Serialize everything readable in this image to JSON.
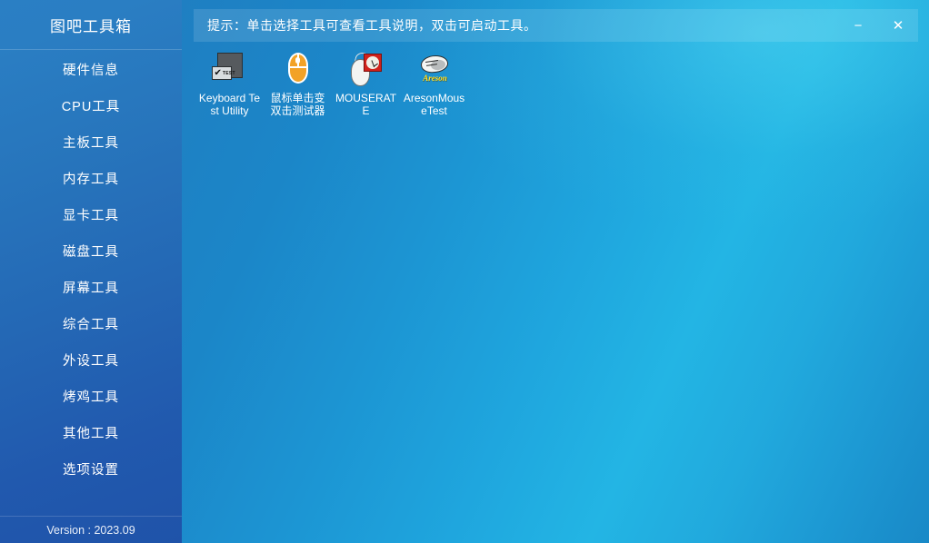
{
  "sidebar": {
    "title": "图吧工具箱",
    "items": [
      {
        "label": "硬件信息",
        "name": "sidebar-item-hardware-info"
      },
      {
        "label": "CPU工具",
        "name": "sidebar-item-cpu-tools"
      },
      {
        "label": "主板工具",
        "name": "sidebar-item-motherboard-tools"
      },
      {
        "label": "内存工具",
        "name": "sidebar-item-memory-tools"
      },
      {
        "label": "显卡工具",
        "name": "sidebar-item-gpu-tools"
      },
      {
        "label": "磁盘工具",
        "name": "sidebar-item-disk-tools"
      },
      {
        "label": "屏幕工具",
        "name": "sidebar-item-screen-tools"
      },
      {
        "label": "综合工具",
        "name": "sidebar-item-general-tools"
      },
      {
        "label": "外设工具",
        "name": "sidebar-item-peripheral-tools"
      },
      {
        "label": "烤鸡工具",
        "name": "sidebar-item-stress-test-tools"
      },
      {
        "label": "其他工具",
        "name": "sidebar-item-other-tools"
      },
      {
        "label": "选项设置",
        "name": "sidebar-item-settings"
      }
    ],
    "version": "Version : 2023.09"
  },
  "titlebar": {
    "hint": "提示：单击选择工具可查看工具说明，双击可启动工具。",
    "minimize_label": "−",
    "close_label": "✕",
    "minimize_icon": "minimize-icon",
    "close_icon": "close-icon"
  },
  "tools": [
    {
      "label": "Keyboard Test Utility",
      "icon": "keyboard-test-icon"
    },
    {
      "label": "鼠标单击变双击测试器",
      "icon": "orange-mouse-icon"
    },
    {
      "label": "MOUSERATE",
      "icon": "mouse-clock-icon"
    },
    {
      "label": "AresonMouseTest",
      "icon": "areson-mouse-icon"
    }
  ],
  "icon_text": {
    "keyboard_test_badge": "TEST",
    "keyboard_test_check": "✔",
    "areson_brand": "Areson"
  },
  "colors": {
    "sidebar_top": "#2a7fc4",
    "sidebar_bottom": "#1f53a9",
    "main_left": "#1f7fc2",
    "main_accent_cyan": "#23b5e4",
    "main_bottom_right": "#1a8cc8",
    "hint_band": "rgba(255,255,255,0.12)",
    "text_white": "#ffffff",
    "icon_orange": "#f2a227",
    "icon_red": "#d1221c",
    "icon_yellow": "#f5e23a",
    "icon_dark_gray": "#565a5e"
  }
}
